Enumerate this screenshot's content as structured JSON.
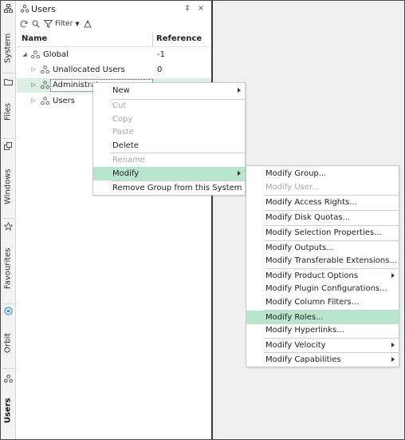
{
  "rail": {
    "system_label": "System",
    "files_label": "Files",
    "windows_label": "Windows",
    "favourites_label": "Favourites",
    "orbit_label": "Orbit",
    "users_label": "Users",
    "icons": [
      "hierarchy-icon",
      "folder-icon",
      "windows-icon",
      "star-icon",
      "orbit-icon",
      "users-icon"
    ]
  },
  "panel": {
    "title": "Users",
    "pin_glyph": "‡",
    "close_glyph": "×",
    "toolbar": {
      "filter_label": "Filter"
    },
    "columns": {
      "name": "Name",
      "reference": "Reference"
    },
    "rows": [
      {
        "name": "Global",
        "reference": "-1",
        "level": 0,
        "expander": "◢"
      },
      {
        "name": "Unallocated Users",
        "reference": "0",
        "level": 1,
        "expander": "▷"
      },
      {
        "name": "Administrat",
        "reference": "",
        "level": 1,
        "expander": "▷",
        "selected": true
      },
      {
        "name": "Users",
        "reference": "",
        "level": 1,
        "expander": "▷"
      }
    ]
  },
  "context_menu": {
    "items": [
      {
        "label": "New",
        "disabled": false,
        "submenu": true
      },
      {
        "label": "Cut",
        "disabled": true
      },
      {
        "label": "Copy",
        "disabled": true
      },
      {
        "label": "Paste",
        "disabled": true
      },
      {
        "label": "Delete",
        "disabled": false
      },
      {
        "label": "Rename",
        "disabled": true
      },
      {
        "label": "Modify",
        "disabled": false,
        "submenu": true,
        "highlighted": true
      },
      {
        "label": "Remove Group from this System",
        "disabled": false
      }
    ]
  },
  "submenu": {
    "items": [
      {
        "label": "Modify Group...",
        "disabled": false
      },
      {
        "label": "Modify User...",
        "disabled": true
      },
      {
        "label": "Modify Access Rights...",
        "disabled": false
      },
      {
        "label": "Modify Disk Quotas...",
        "disabled": false
      },
      {
        "label": "Modify Selection Properties...",
        "disabled": false
      },
      {
        "label": "Modify Outputs...",
        "disabled": false
      },
      {
        "label": "Modify Transferable Extensions...",
        "disabled": false
      },
      {
        "label": "Modify Product Options",
        "disabled": false,
        "submenu": true
      },
      {
        "label": "Modify Plugin Configurations...",
        "disabled": false
      },
      {
        "label": "Modify Column Filters...",
        "disabled": false
      },
      {
        "label": "Modify Roles...",
        "disabled": false,
        "highlighted": true
      },
      {
        "label": "Modify Hyperlinks...",
        "disabled": false
      },
      {
        "label": "Modify Velocity",
        "disabled": false,
        "submenu": true
      },
      {
        "label": "Modify Capabilities",
        "disabled": false,
        "submenu": true
      }
    ]
  },
  "colors": {
    "selection": "#dcefe3",
    "menu_highlight": "#b8e6cc",
    "workspace": "#f0f0f0",
    "disabled_text": "#a8a8a8"
  }
}
